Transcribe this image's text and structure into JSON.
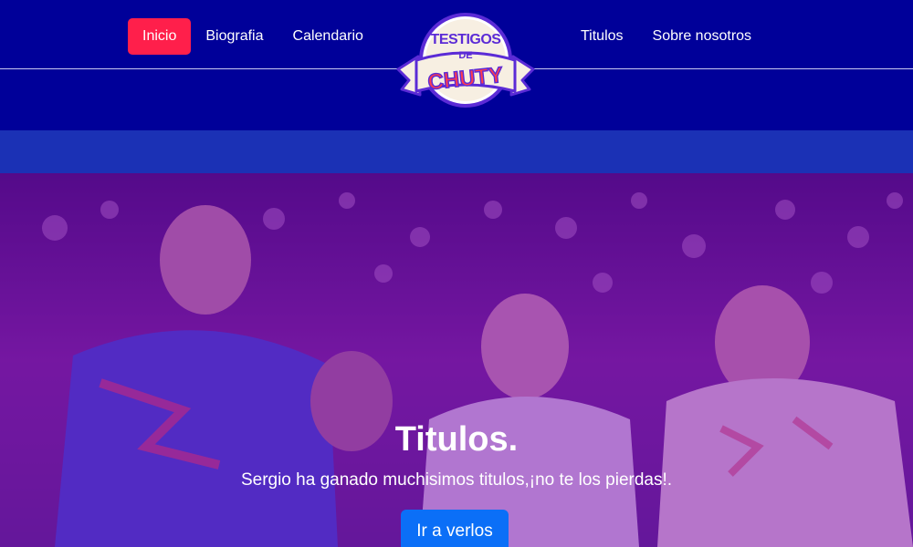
{
  "nav": {
    "left": [
      {
        "label": "Inicio",
        "active": true
      },
      {
        "label": "Biografia",
        "active": false
      },
      {
        "label": "Calendario",
        "active": false
      }
    ],
    "right": [
      {
        "label": "Titulos",
        "active": false
      },
      {
        "label": "Sobre nosotros",
        "active": false
      }
    ]
  },
  "logo": {
    "line1": "TESTIGOS",
    "line2": "DE",
    "line3": "CHUTY"
  },
  "hero": {
    "title": "Titulos.",
    "subtitle": "Sergio ha ganado muchisimos titulos,¡no te los pierdas!.",
    "button_label": "Ir a verlos"
  },
  "colors": {
    "header_bg": "#000099",
    "active_nav": "#ff1f4b",
    "subband": "#1b31b5",
    "button": "#0b6ff7",
    "hero_tint": "#6e00aa"
  }
}
